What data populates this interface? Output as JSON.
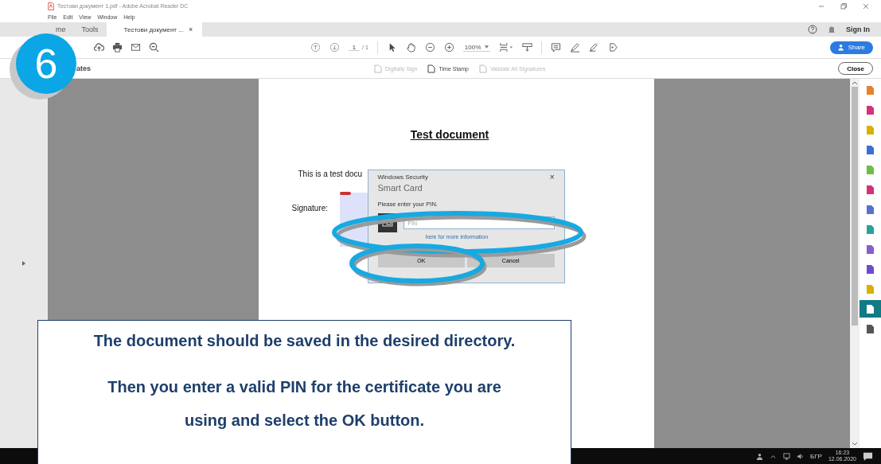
{
  "window": {
    "title": "Тестови документ 1.pdf - Adobe Acrobat Reader DC"
  },
  "menu": [
    "File",
    "Edit",
    "View",
    "Window",
    "Help"
  ],
  "tabs": [
    {
      "label": "me",
      "selected": false
    },
    {
      "label": "Tools",
      "selected": false
    },
    {
      "label": "Тестови документ ...",
      "selected": true,
      "close": "×"
    }
  ],
  "account": {
    "sign_in": "Sign In"
  },
  "toolbar": {
    "page": "1",
    "page_total": "/ 1",
    "zoom": "100%",
    "share": "Share"
  },
  "certificates_bar": {
    "title": "ates",
    "tools": [
      {
        "label": "Digitally Sign",
        "disabled": true
      },
      {
        "label": "Time Stamp",
        "disabled": false
      },
      {
        "label": "Validate All Signatures",
        "disabled": true
      }
    ],
    "close": "Close"
  },
  "document": {
    "heading": "Test document",
    "body": "This is a test docu",
    "signature_label": "Signature:"
  },
  "dialog": {
    "caption": "Windows Security",
    "close": "×",
    "title": "Smart Card",
    "prompt": "Please enter your PIN.",
    "pin_placeholder": "PIN",
    "link": "here for more information",
    "buttons": [
      "OK",
      "Cancel"
    ]
  },
  "tool_panel": [
    {
      "color": "#e8822a",
      "selected": false
    },
    {
      "color": "#d6307a",
      "selected": false
    },
    {
      "color": "#d9b000",
      "selected": false
    },
    {
      "color": "#3a6fd8",
      "selected": false
    },
    {
      "color": "#6cbe45",
      "selected": false
    },
    {
      "color": "#d6307a",
      "selected": false
    },
    {
      "color": "#5a6fd0",
      "selected": false
    },
    {
      "color": "#2aa198",
      "selected": false
    },
    {
      "color": "#8a5ccf",
      "selected": false
    },
    {
      "color": "#6a4ccf",
      "selected": false
    },
    {
      "color": "#d9b000",
      "selected": false
    },
    {
      "color": "#ffffff",
      "selected": true
    },
    {
      "color": "#555555",
      "selected": false
    }
  ],
  "taskbar": {
    "language": "БГР",
    "time": "16:23",
    "date": "12.06.2020"
  },
  "step": {
    "number": "6"
  },
  "callout": {
    "paragraphs": [
      "The document should be saved in the desired directory.",
      "Then you enter a valid PIN for the certificate you are using and select the OK button."
    ]
  }
}
